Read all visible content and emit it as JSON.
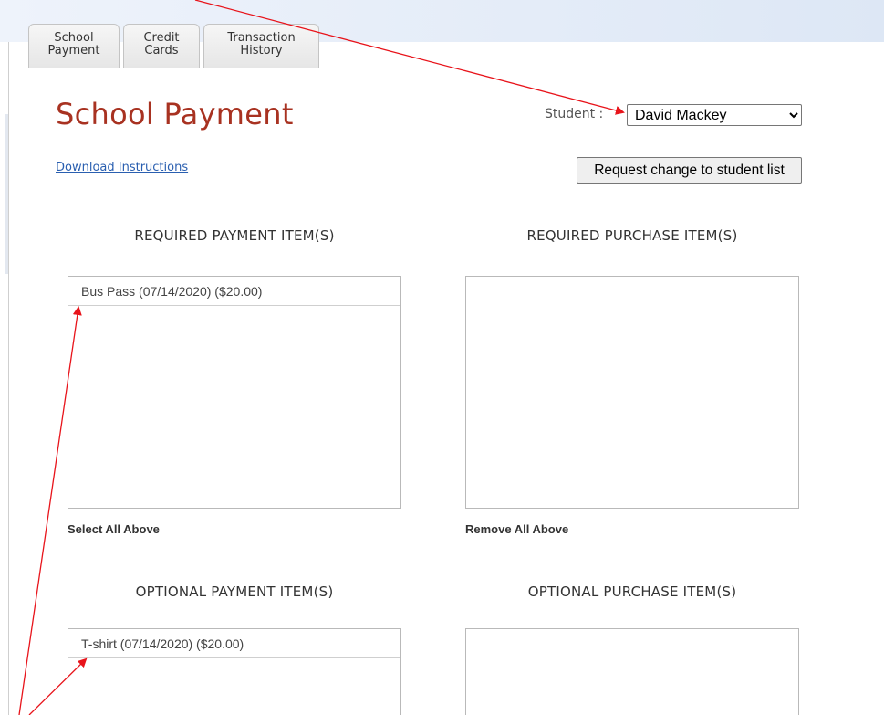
{
  "tabs": [
    {
      "label_line1": "School",
      "label_line2": "Payment"
    },
    {
      "label_line1": "Credit",
      "label_line2": "Cards"
    },
    {
      "label_line1": "Transaction",
      "label_line2": "History"
    }
  ],
  "page_title": "School Payment",
  "student": {
    "label": "Student :",
    "selected": "David Mackey"
  },
  "download_link": "Download Instructions",
  "request_button": "Request change to student list",
  "required_payment": {
    "heading": "REQUIRED PAYMENT ITEM(S)",
    "items": [
      "Bus Pass (07/14/2020) ($20.00)"
    ],
    "select_all": "Select All Above"
  },
  "required_purchase": {
    "heading": "REQUIRED PURCHASE ITEM(S)",
    "items": [],
    "remove_all": "Remove All Above"
  },
  "optional_payment": {
    "heading": "OPTIONAL PAYMENT ITEM(S)",
    "items": [
      "T-shirt (07/14/2020) ($20.00)"
    ]
  },
  "optional_purchase": {
    "heading": "OPTIONAL PURCHASE ITEM(S)",
    "items": []
  },
  "colors": {
    "title": "#a83221",
    "link": "#2a5fb0",
    "annotation_arrow": "#e8141b"
  }
}
